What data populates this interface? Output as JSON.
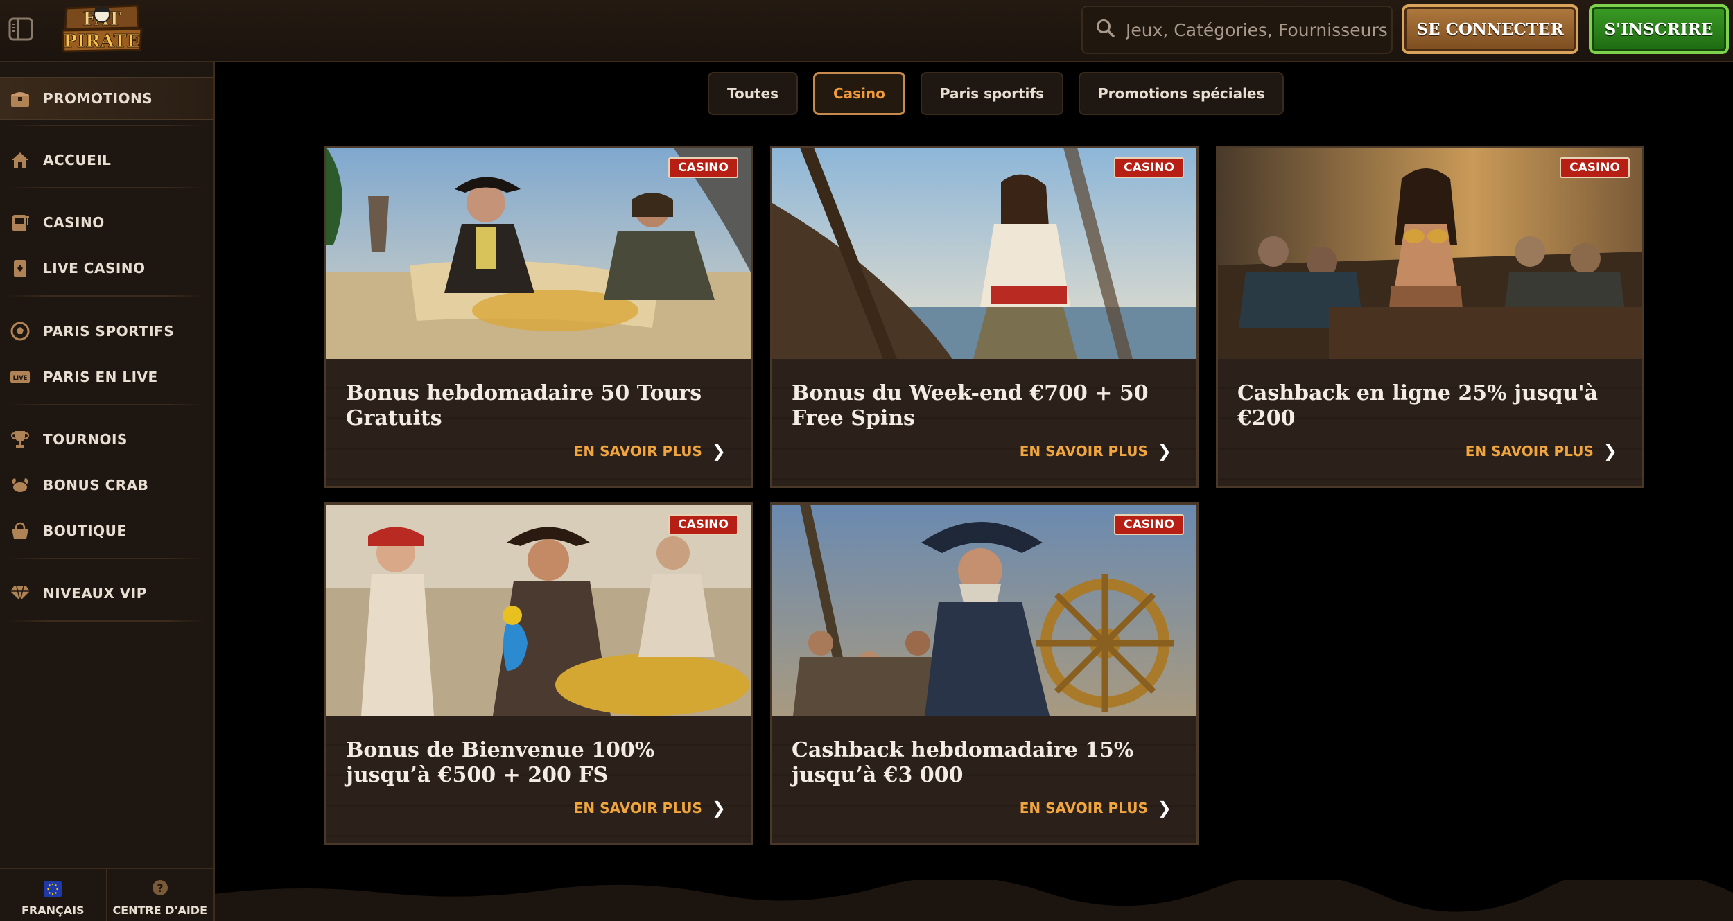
{
  "header": {
    "logo_text_line1": "FAT",
    "logo_text_line2": "PIRATE",
    "search_placeholder": "Jeux, Catégories, Fournisseurs",
    "login_label": "SE CONNECTER",
    "signup_label": "S'INSCRIRE"
  },
  "sidebar": {
    "items": [
      {
        "label": "PROMOTIONS",
        "icon": "treasure-chest-icon"
      },
      {
        "label": "ACCUEIL",
        "icon": "home-icon"
      },
      {
        "label": "CASINO",
        "icon": "slot-machine-icon"
      },
      {
        "label": "LIVE CASINO",
        "icon": "playing-card-icon"
      },
      {
        "label": "PARIS SPORTIFS",
        "icon": "soccer-ball-icon"
      },
      {
        "label": "PARIS EN LIVE",
        "icon": "live-badge-icon"
      },
      {
        "label": "TOURNOIS",
        "icon": "trophy-icon"
      },
      {
        "label": "BONUS CRAB",
        "icon": "crab-icon"
      },
      {
        "label": "BOUTIQUE",
        "icon": "shopping-basket-icon"
      },
      {
        "label": "NIVEAUX VIP",
        "icon": "diamond-icon"
      }
    ],
    "footer": {
      "language_label": "FRANÇAIS",
      "help_label": "CENTRE D'AIDE",
      "help_icon_glyph": "?"
    }
  },
  "tabs": {
    "items": [
      "Toutes",
      "Casino",
      "Paris sportifs",
      "Promotions spéciales"
    ],
    "active": "Casino"
  },
  "cards": [
    {
      "badge": "CASINO",
      "title": "Bonus hebdomadaire 50 Tours Gratuits",
      "cta": "EN SAVOIR PLUS"
    },
    {
      "badge": "CASINO",
      "title": "Bonus du Week-end €700 + 50 Free Spins",
      "cta": "EN SAVOIR PLUS"
    },
    {
      "badge": "CASINO",
      "title": "Cashback en ligne 25% jusqu'à €200",
      "cta": "EN SAVOIR PLUS"
    },
    {
      "badge": "CASINO",
      "title": "Bonus de Bienvenue 100% jusqu’à €500 + 200 FS",
      "cta": "EN SAVOIR PLUS"
    },
    {
      "badge": "CASINO",
      "title": "Cashback hebdomadaire 15% jusqu’à €3 000",
      "cta": "EN SAVOIR PLUS"
    }
  ],
  "colors": {
    "accent_orange": "#f0a53e",
    "badge_red": "#b71f14",
    "login_brown": "#9a6530",
    "signup_green": "#2e8a1c"
  }
}
